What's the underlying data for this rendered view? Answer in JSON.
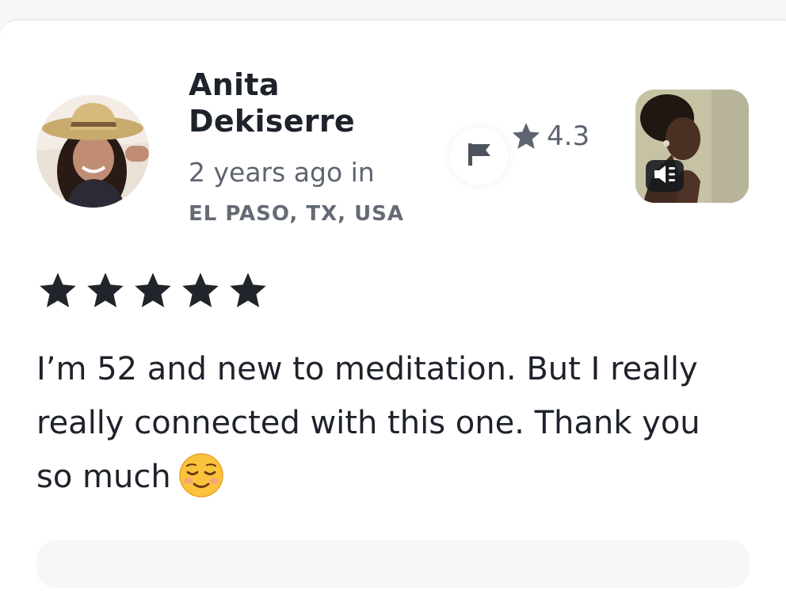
{
  "review": {
    "author_name": "Anita Dekiserre",
    "time_ago": "2 years ago in",
    "location": "EL PASO, TX, USA",
    "text": "I’m 52 and new to meditation. But I really really connected with this one. Thank you so much",
    "emoji": "☺️",
    "stars": 5
  },
  "track": {
    "rating": "4.3"
  },
  "icons": {
    "flag": "flag-icon",
    "star": "star-icon",
    "audio": "speaker-icon"
  },
  "colors": {
    "text_primary": "#1e222b",
    "text_secondary": "#5e6570",
    "star": "#21242b",
    "background": "#ffffff"
  }
}
